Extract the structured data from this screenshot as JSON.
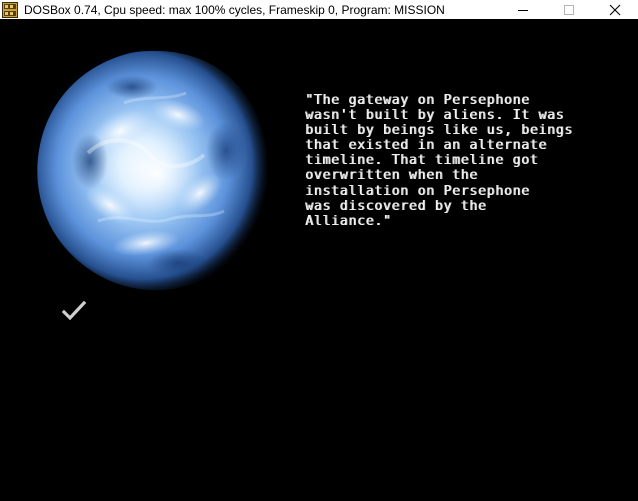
{
  "window": {
    "title": "DOSBox 0.74, Cpu speed: max 100% cycles, Frameskip  0, Program:  MISSION",
    "app_icon": "dosbox-icon",
    "controls": [
      "minimize-icon",
      "maximize-icon",
      "close-icon"
    ]
  },
  "game": {
    "dialog_text": "\"The gateway on Persephone\nwasn't built by aliens. It was\nbuilt by beings like us, beings\nthat existed in an alternate\ntimeline. That timeline got\noverwritten when the\ninstallation on Persephone\nwas discovered by the\nAlliance.\"",
    "portrait": "blue-nebula-planet",
    "confirm_icon": "checkmark-icon"
  },
  "colors": {
    "titlebar": "#ffffff",
    "screen": "#000000",
    "text": "#f2f2f2",
    "nebula": "#6fa6e8"
  }
}
